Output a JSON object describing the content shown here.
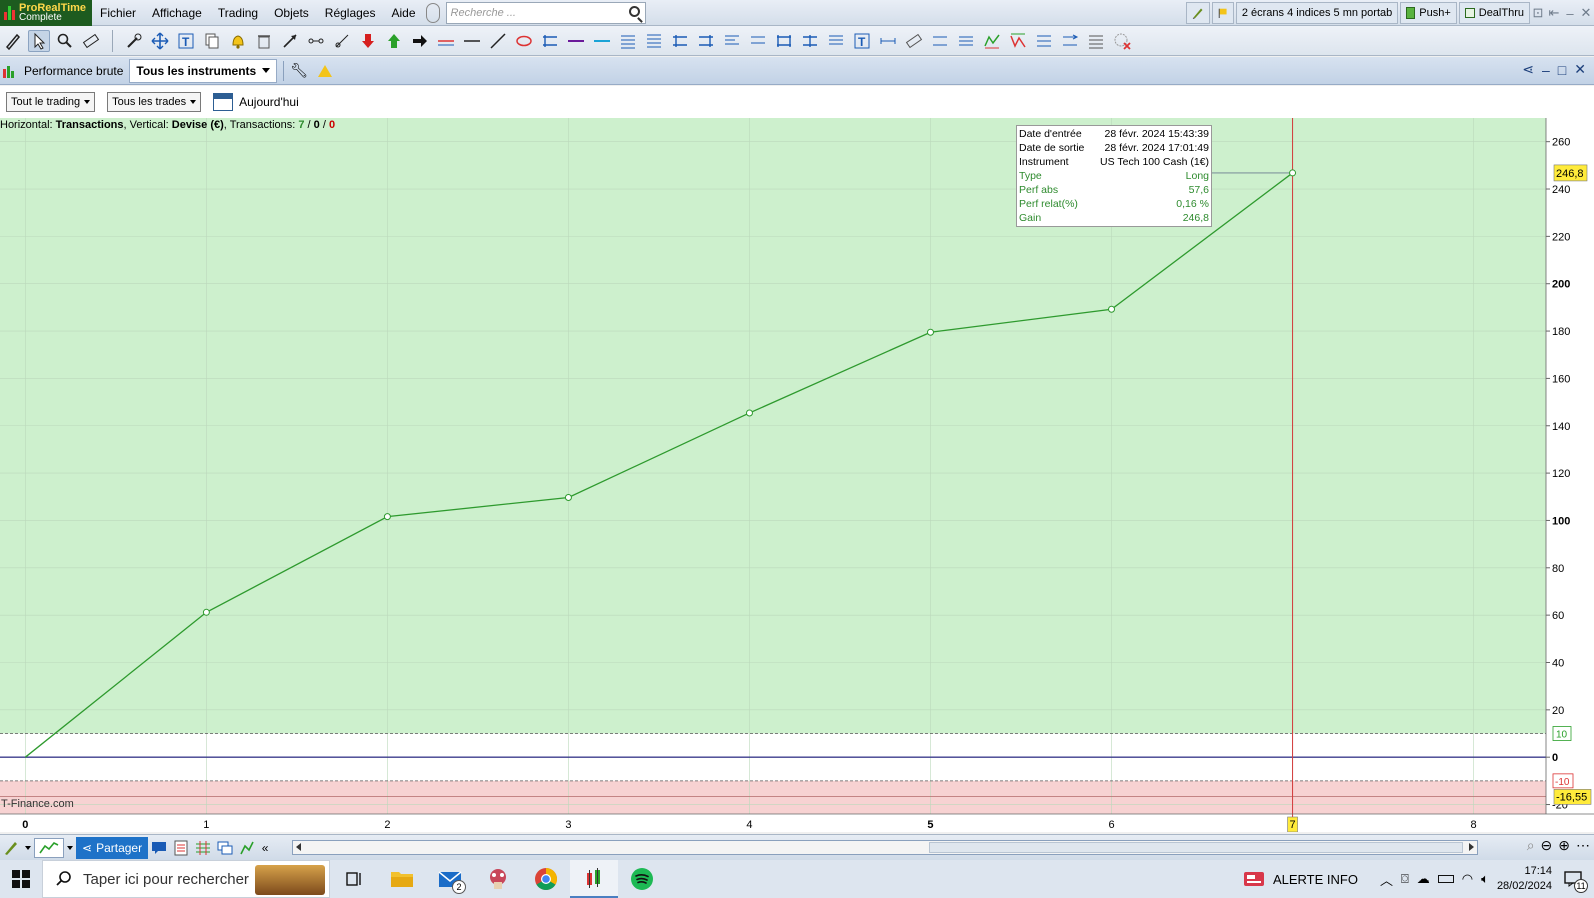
{
  "app": {
    "logo_line1": "ProRealTime",
    "logo_line2": "Complete",
    "menu": [
      "Fichier",
      "Affichage",
      "Trading",
      "Objets",
      "Réglages",
      "Aide"
    ],
    "search_placeholder": "Recherche ...",
    "workspace_label": "2 écrans 4 indices 5 mn portab",
    "push_label": "Push+",
    "dealthru_label": "DealThru"
  },
  "window": {
    "perf_label": "Performance brute",
    "instrument_selector": "Tous les instruments"
  },
  "filters": {
    "trading_scope": "Tout le trading",
    "trades_scope": "Tous les trades",
    "date_label": "Aujourd'hui"
  },
  "chart_info": {
    "prefix_h": "Horizontal: ",
    "h_value": "Transactions",
    "prefix_v": ", Vertical: ",
    "v_value": "Devise (€)",
    "prefix_t": ", Transactions: ",
    "count_total": "7",
    "count_mid": "0",
    "count_loss": "0",
    "sep": " / "
  },
  "tooltip": {
    "rows": [
      {
        "label": "Date d'entrée",
        "value": "28 févr. 2024 15:43:39",
        "color": "#000000"
      },
      {
        "label": "Date de sortie",
        "value": "28 févr. 2024 17:01:49",
        "color": "#000000"
      },
      {
        "label": "Instrument",
        "value": "US Tech 100 Cash (1€)",
        "color": "#000000"
      },
      {
        "label": "Type",
        "value": "Long",
        "color": "#2e8b2e"
      },
      {
        "label": "Perf abs",
        "value": "57,6",
        "color": "#2e8b2e"
      },
      {
        "label": "Perf relat(%)",
        "value": "0,16 %",
        "color": "#2e8b2e"
      },
      {
        "label": "Gain",
        "value": "246,8",
        "color": "#2e8b2e"
      }
    ]
  },
  "chart_data": {
    "type": "line",
    "x": [
      0,
      1,
      2,
      3,
      4,
      5,
      6,
      7
    ],
    "y": [
      0,
      61.2,
      101.6,
      109.7,
      145.4,
      179.5,
      189.2,
      246.8
    ],
    "x_ticks": [
      "0",
      "1",
      "2",
      "3",
      "4",
      "5",
      "6",
      "7",
      "8"
    ],
    "y_ticks": [
      "260",
      "240",
      "220",
      "200",
      "180",
      "160",
      "140",
      "120",
      "100",
      "80",
      "60",
      "40",
      "20",
      "0",
      "-20"
    ],
    "y_tick_values": [
      260,
      240,
      220,
      200,
      180,
      160,
      140,
      120,
      100,
      80,
      60,
      40,
      20,
      0,
      -20
    ],
    "xlim": [
      -0.14,
      8.4
    ],
    "ylim": [
      -24,
      270
    ],
    "grid": true,
    "selected_x": 7,
    "selected_x_label": "7",
    "current_value_label": "246,8",
    "upper_threshold": 10,
    "upper_threshold_label": "10",
    "lower_threshold": -10,
    "lower_threshold_label": "-10",
    "drawdown_value": -16.55,
    "drawdown_label": "-16,55",
    "colors": {
      "positive_zone": "#cdf0cd",
      "negative_zone": "#f7d2d2",
      "line": "#2e9a2e",
      "zero_line": "#3b3b8c",
      "cursor": "#d43a3a",
      "highlight": "#ffeb3b"
    }
  },
  "watermark": "T-Finance.com",
  "bottom": {
    "share_label": "Partager"
  },
  "taskbar": {
    "search_placeholder": "Taper ici pour rechercher",
    "mail_badge": "2",
    "alert_label": "ALERTE INFO",
    "time": "17:14",
    "date": "28/02/2024",
    "notif_count": "11"
  }
}
